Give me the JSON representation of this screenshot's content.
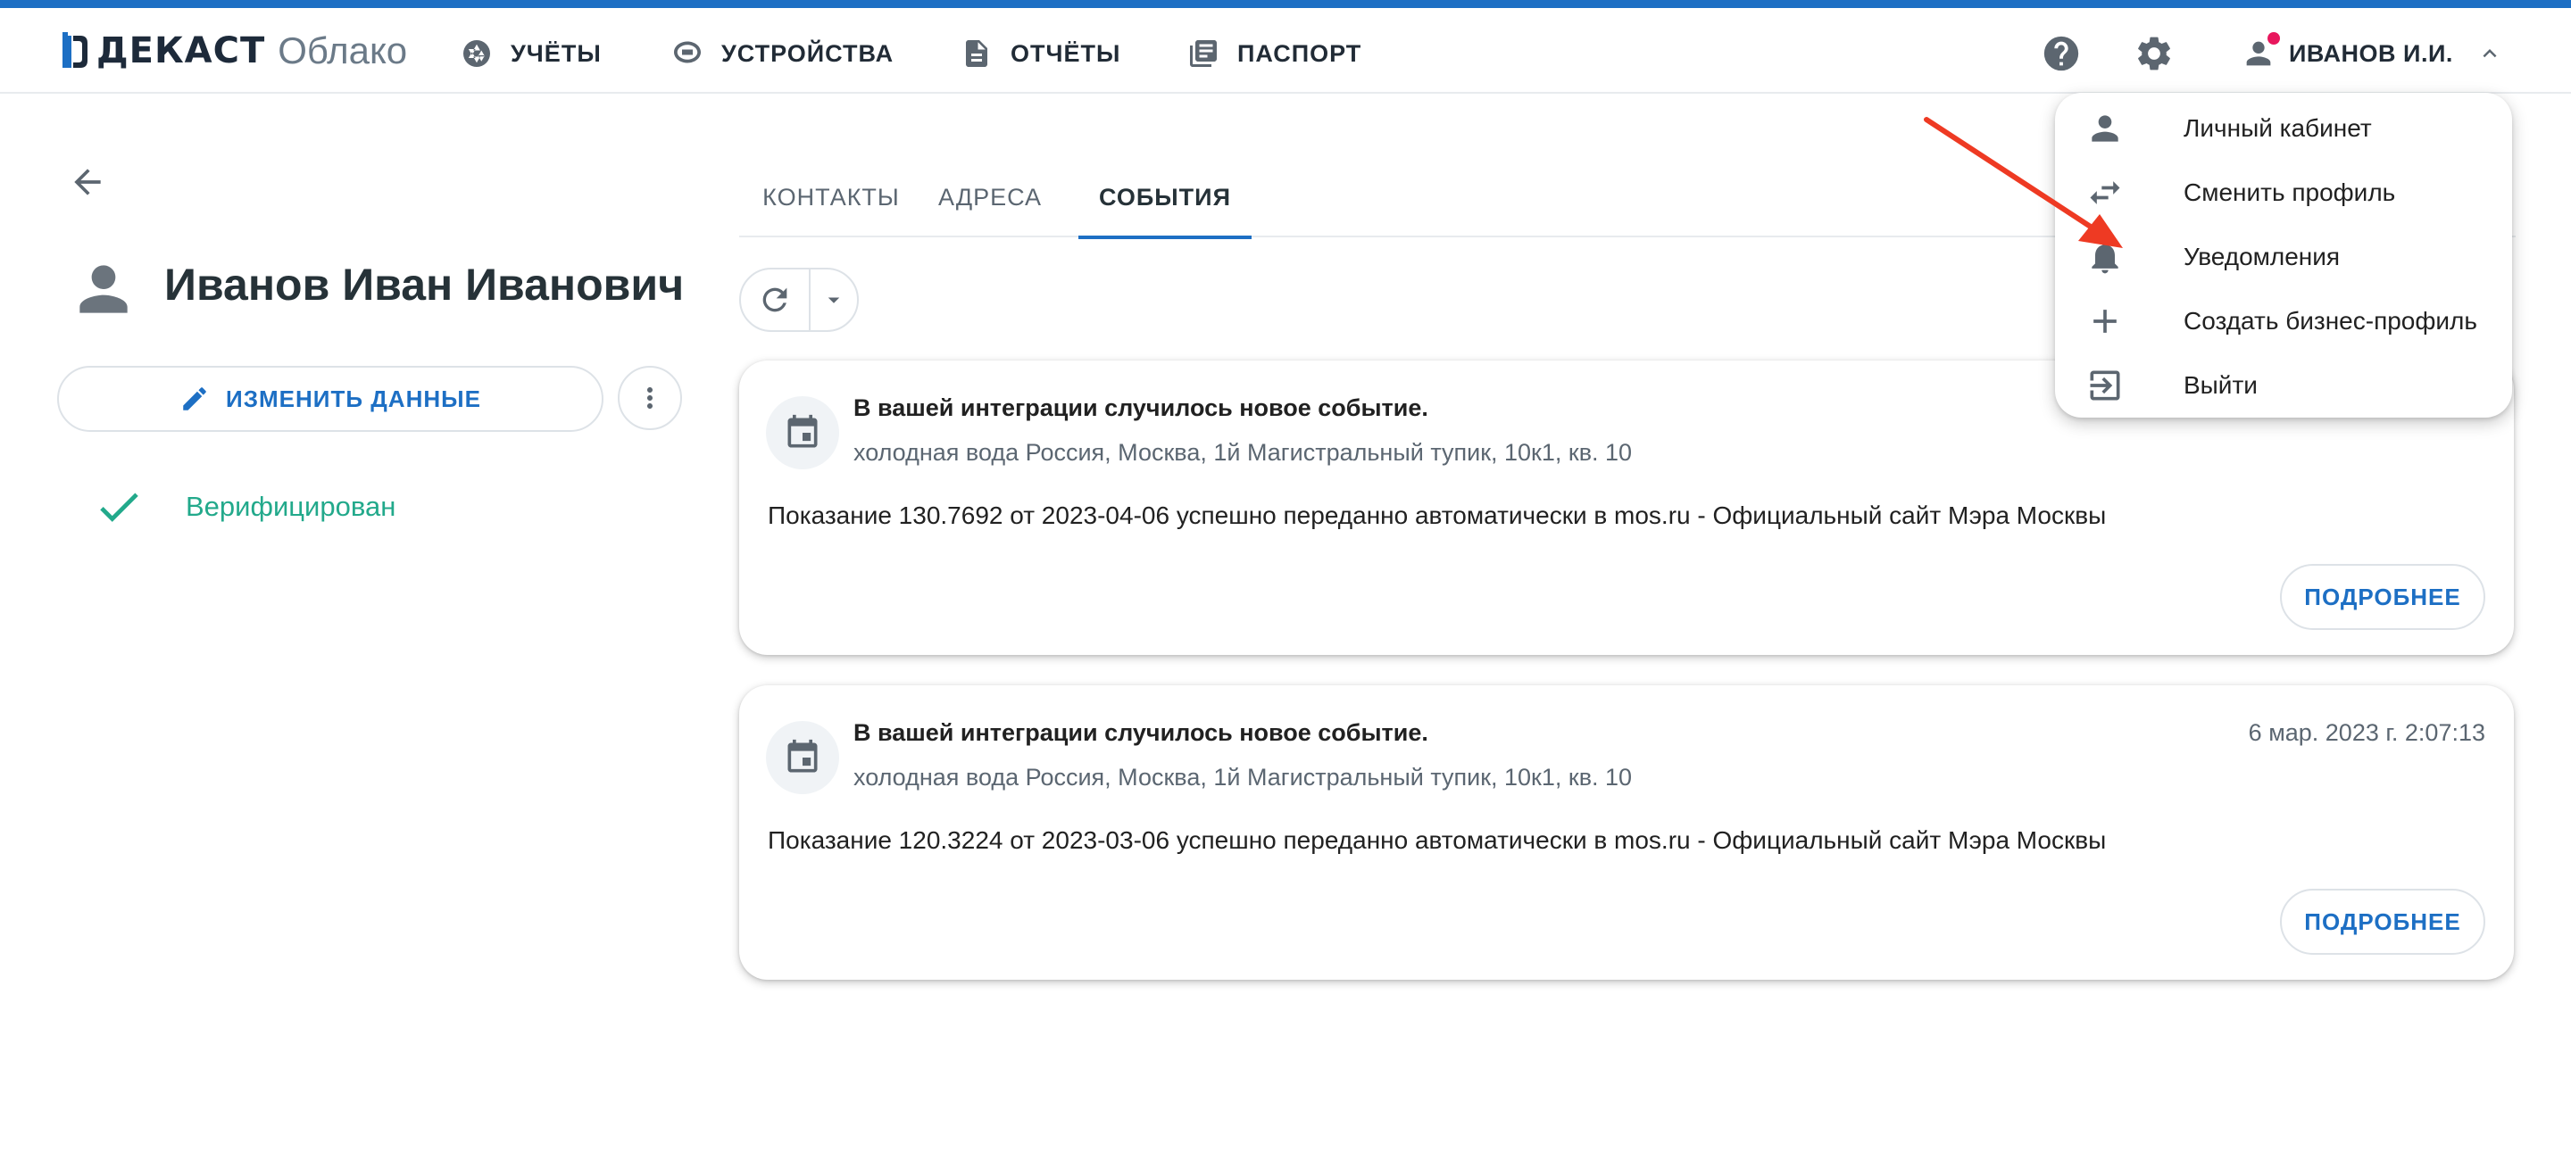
{
  "header": {
    "logo_brand": "ДЕКАСТ",
    "logo_product": "Облако",
    "nav": [
      {
        "label": "УЧЁТЫ",
        "icon": "shutter-icon"
      },
      {
        "label": "УСТРОЙСТВА",
        "icon": "meter-icon"
      },
      {
        "label": "ОТЧЁТЫ",
        "icon": "document-icon"
      },
      {
        "label": "ПАСПОРТ",
        "icon": "library-icon"
      }
    ],
    "help_icon": "help-icon",
    "settings_icon": "gear-icon",
    "user_label": "ИВАНОВ И.И."
  },
  "profile": {
    "name": "Иванов Иван Иванович",
    "edit_label": "ИЗМЕНИТЬ ДАННЫЕ",
    "verified_label": "Верифицирован"
  },
  "tabs": [
    {
      "label": "КОНТАКТЫ"
    },
    {
      "label": "АДРЕСА"
    },
    {
      "label": "СОБЫТИЯ",
      "active": true
    }
  ],
  "events": [
    {
      "title": "В вашей интеграции случилось новое событие.",
      "subtitle": "холодная вода Россия, Москва, 1й Магистральный тупик, 10к1, кв. 10",
      "date": "",
      "message": "Показание 130.7692 от 2023-04-06 успешно переданно автоматически в mos.ru - Официальный сайт Мэра Москвы",
      "more_label": "ПОДРОБНЕЕ"
    },
    {
      "title": "В вашей интеграции случилось новое событие.",
      "subtitle": "холодная вода Россия, Москва, 1й Магистральный тупик, 10к1, кв. 10",
      "date": "6 мар. 2023 г. 2:07:13",
      "message": "Показание 120.3224 от 2023-03-06 успешно переданно автоматически в mos.ru - Официальный сайт Мэра Москвы",
      "more_label": "ПОДРОБНЕЕ"
    }
  ],
  "user_dropdown": {
    "items": [
      {
        "label": "Личный кабинет",
        "icon": "person-icon"
      },
      {
        "label": "Сменить профиль",
        "icon": "swap-icon"
      },
      {
        "label": "Уведомления",
        "icon": "bell-icon"
      },
      {
        "label": "Создать бизнес-профиль",
        "icon": "plus-icon"
      },
      {
        "label": "Выйти",
        "icon": "logout-icon"
      }
    ]
  },
  "colors": {
    "accent": "#1d6fc4",
    "verified": "#22a98b",
    "notification_dot": "#e8175d",
    "annotation_arrow": "#ee3a23"
  }
}
